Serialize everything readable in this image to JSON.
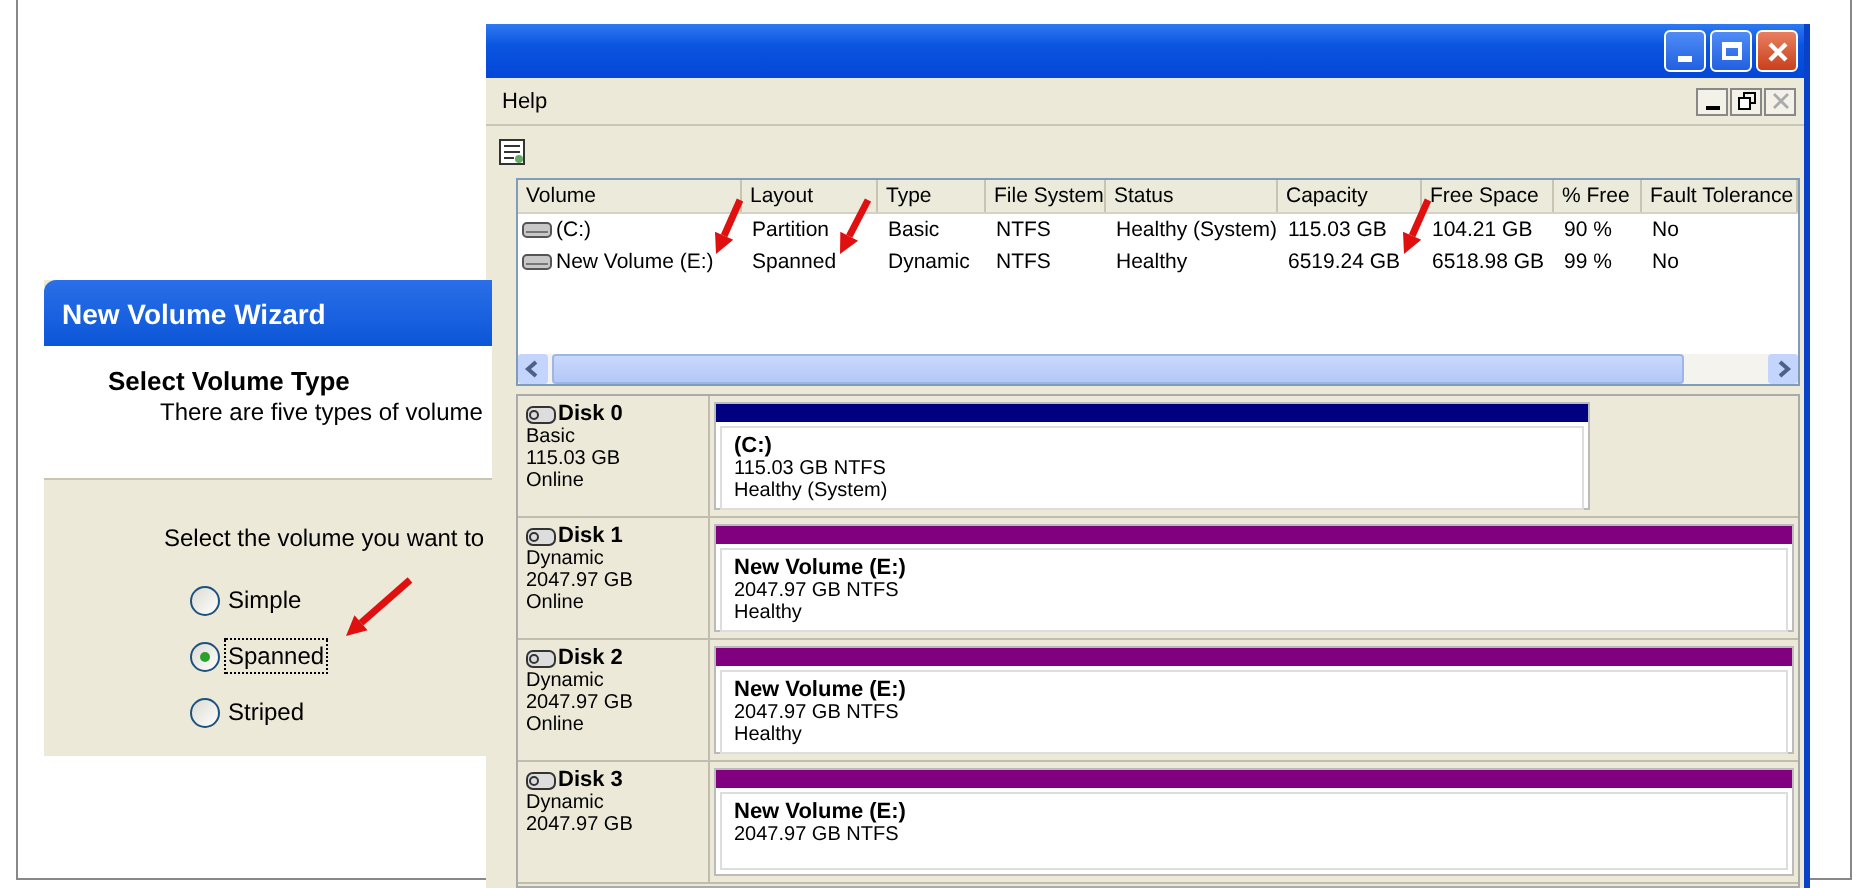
{
  "disk_management": {
    "menu": [
      {
        "label": "Help"
      }
    ],
    "volume_table": {
      "columns": [
        "Volume",
        "Layout",
        "Type",
        "File System",
        "Status",
        "Capacity",
        "Free Space",
        "% Free",
        "Fault Tolerance"
      ],
      "rows": [
        {
          "cells": [
            "(C:)",
            "Partition",
            "Basic",
            "NTFS",
            "Healthy (System)",
            "115.03 GB",
            "104.21 GB",
            "90 %",
            "No"
          ]
        },
        {
          "cells": [
            "New Volume (E:)",
            "Spanned",
            "Dynamic",
            "NTFS",
            "Healthy",
            "6519.24 GB",
            "6518.98 GB",
            "99 %",
            "No"
          ]
        }
      ]
    },
    "disks": [
      {
        "name": "Disk 0",
        "type": "Basic",
        "size": "115.03 GB",
        "status": "Online",
        "partition": {
          "kind": "partial",
          "color": "#000080",
          "name": "(C:)",
          "detail": "115.03 GB NTFS",
          "health": "Healthy (System)"
        }
      },
      {
        "name": "Disk 1",
        "type": "Dynamic",
        "size": "2047.97 GB",
        "status": "Online",
        "partition": {
          "kind": "full",
          "color": "#800080",
          "name": "New Volume  (E:)",
          "detail": "2047.97 GB NTFS",
          "health": "Healthy"
        }
      },
      {
        "name": "Disk 2",
        "type": "Dynamic",
        "size": "2047.97 GB",
        "status": "Online",
        "partition": {
          "kind": "full",
          "color": "#800080",
          "name": "New Volume  (E:)",
          "detail": "2047.97 GB NTFS",
          "health": "Healthy"
        }
      },
      {
        "name": "Disk 3",
        "type": "Dynamic",
        "size": "2047.97 GB",
        "partition": {
          "kind": "full",
          "color": "#800080",
          "name": "New Volume  (E:)",
          "detail": "2047.97 GB NTFS"
        }
      }
    ]
  },
  "wizard": {
    "title": "New Volume Wizard",
    "heading": "Select Volume Type",
    "subheading": "There are five types of volume",
    "prompt": "Select the volume you want to",
    "options": [
      {
        "label": "Simple",
        "selected": false
      },
      {
        "label": "Spanned",
        "selected": true
      },
      {
        "label": "Striped",
        "selected": false
      }
    ]
  }
}
